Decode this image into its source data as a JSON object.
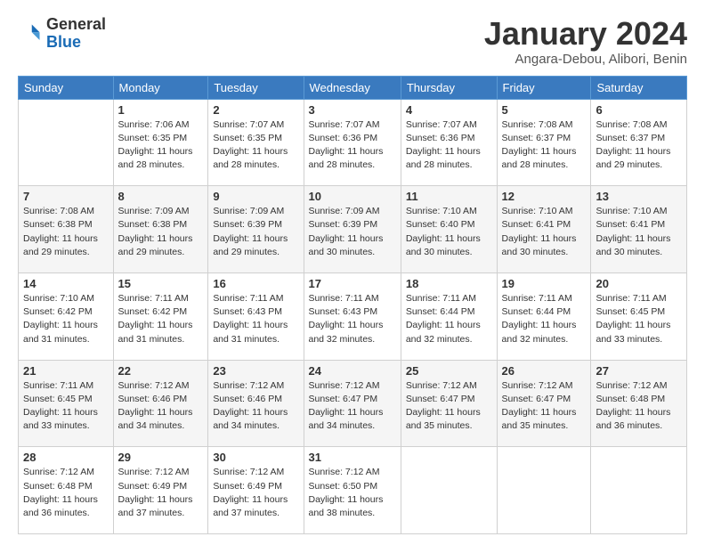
{
  "logo": {
    "general": "General",
    "blue": "Blue"
  },
  "header": {
    "month": "January 2024",
    "location": "Angara-Debou, Alibori, Benin"
  },
  "weekdays": [
    "Sunday",
    "Monday",
    "Tuesday",
    "Wednesday",
    "Thursday",
    "Friday",
    "Saturday"
  ],
  "weeks": [
    [
      {
        "day": "",
        "info": ""
      },
      {
        "day": "1",
        "info": "Sunrise: 7:06 AM\nSunset: 6:35 PM\nDaylight: 11 hours\nand 28 minutes."
      },
      {
        "day": "2",
        "info": "Sunrise: 7:07 AM\nSunset: 6:35 PM\nDaylight: 11 hours\nand 28 minutes."
      },
      {
        "day": "3",
        "info": "Sunrise: 7:07 AM\nSunset: 6:36 PM\nDaylight: 11 hours\nand 28 minutes."
      },
      {
        "day": "4",
        "info": "Sunrise: 7:07 AM\nSunset: 6:36 PM\nDaylight: 11 hours\nand 28 minutes."
      },
      {
        "day": "5",
        "info": "Sunrise: 7:08 AM\nSunset: 6:37 PM\nDaylight: 11 hours\nand 28 minutes."
      },
      {
        "day": "6",
        "info": "Sunrise: 7:08 AM\nSunset: 6:37 PM\nDaylight: 11 hours\nand 29 minutes."
      }
    ],
    [
      {
        "day": "7",
        "info": "Sunrise: 7:08 AM\nSunset: 6:38 PM\nDaylight: 11 hours\nand 29 minutes."
      },
      {
        "day": "8",
        "info": "Sunrise: 7:09 AM\nSunset: 6:38 PM\nDaylight: 11 hours\nand 29 minutes."
      },
      {
        "day": "9",
        "info": "Sunrise: 7:09 AM\nSunset: 6:39 PM\nDaylight: 11 hours\nand 29 minutes."
      },
      {
        "day": "10",
        "info": "Sunrise: 7:09 AM\nSunset: 6:39 PM\nDaylight: 11 hours\nand 30 minutes."
      },
      {
        "day": "11",
        "info": "Sunrise: 7:10 AM\nSunset: 6:40 PM\nDaylight: 11 hours\nand 30 minutes."
      },
      {
        "day": "12",
        "info": "Sunrise: 7:10 AM\nSunset: 6:41 PM\nDaylight: 11 hours\nand 30 minutes."
      },
      {
        "day": "13",
        "info": "Sunrise: 7:10 AM\nSunset: 6:41 PM\nDaylight: 11 hours\nand 30 minutes."
      }
    ],
    [
      {
        "day": "14",
        "info": "Sunrise: 7:10 AM\nSunset: 6:42 PM\nDaylight: 11 hours\nand 31 minutes."
      },
      {
        "day": "15",
        "info": "Sunrise: 7:11 AM\nSunset: 6:42 PM\nDaylight: 11 hours\nand 31 minutes."
      },
      {
        "day": "16",
        "info": "Sunrise: 7:11 AM\nSunset: 6:43 PM\nDaylight: 11 hours\nand 31 minutes."
      },
      {
        "day": "17",
        "info": "Sunrise: 7:11 AM\nSunset: 6:43 PM\nDaylight: 11 hours\nand 32 minutes."
      },
      {
        "day": "18",
        "info": "Sunrise: 7:11 AM\nSunset: 6:44 PM\nDaylight: 11 hours\nand 32 minutes."
      },
      {
        "day": "19",
        "info": "Sunrise: 7:11 AM\nSunset: 6:44 PM\nDaylight: 11 hours\nand 32 minutes."
      },
      {
        "day": "20",
        "info": "Sunrise: 7:11 AM\nSunset: 6:45 PM\nDaylight: 11 hours\nand 33 minutes."
      }
    ],
    [
      {
        "day": "21",
        "info": "Sunrise: 7:11 AM\nSunset: 6:45 PM\nDaylight: 11 hours\nand 33 minutes."
      },
      {
        "day": "22",
        "info": "Sunrise: 7:12 AM\nSunset: 6:46 PM\nDaylight: 11 hours\nand 34 minutes."
      },
      {
        "day": "23",
        "info": "Sunrise: 7:12 AM\nSunset: 6:46 PM\nDaylight: 11 hours\nand 34 minutes."
      },
      {
        "day": "24",
        "info": "Sunrise: 7:12 AM\nSunset: 6:47 PM\nDaylight: 11 hours\nand 34 minutes."
      },
      {
        "day": "25",
        "info": "Sunrise: 7:12 AM\nSunset: 6:47 PM\nDaylight: 11 hours\nand 35 minutes."
      },
      {
        "day": "26",
        "info": "Sunrise: 7:12 AM\nSunset: 6:47 PM\nDaylight: 11 hours\nand 35 minutes."
      },
      {
        "day": "27",
        "info": "Sunrise: 7:12 AM\nSunset: 6:48 PM\nDaylight: 11 hours\nand 36 minutes."
      }
    ],
    [
      {
        "day": "28",
        "info": "Sunrise: 7:12 AM\nSunset: 6:48 PM\nDaylight: 11 hours\nand 36 minutes."
      },
      {
        "day": "29",
        "info": "Sunrise: 7:12 AM\nSunset: 6:49 PM\nDaylight: 11 hours\nand 37 minutes."
      },
      {
        "day": "30",
        "info": "Sunrise: 7:12 AM\nSunset: 6:49 PM\nDaylight: 11 hours\nand 37 minutes."
      },
      {
        "day": "31",
        "info": "Sunrise: 7:12 AM\nSunset: 6:50 PM\nDaylight: 11 hours\nand 38 minutes."
      },
      {
        "day": "",
        "info": ""
      },
      {
        "day": "",
        "info": ""
      },
      {
        "day": "",
        "info": ""
      }
    ]
  ]
}
